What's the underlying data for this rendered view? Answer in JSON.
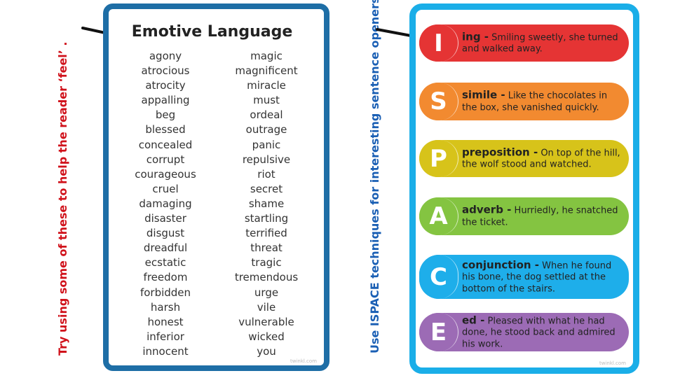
{
  "left_note": "Try using some of these to help the reader ‘feel’ .",
  "right_note": "Use ISPACE techniques for interesting sentence openers!",
  "emotive": {
    "title": "Emotive Language",
    "col1": [
      "agony",
      "atrocious",
      "atrocity",
      "appalling",
      "beg",
      "blessed",
      "concealed",
      "corrupt",
      "courageous",
      "cruel",
      "damaging",
      "disaster",
      "disgust",
      "dreadful",
      "ecstatic",
      "freedom",
      "forbidden",
      "harsh",
      "honest",
      "inferior",
      "innocent"
    ],
    "col2": [
      "magic",
      "magnificent",
      "miracle",
      "must",
      "ordeal",
      "outrage",
      "panic",
      "repulsive",
      "riot",
      "secret",
      "shame",
      "startling",
      "terrified",
      "threat",
      "tragic",
      "tremendous",
      "urge",
      "vile",
      "vulnerable",
      "wicked",
      "you"
    ],
    "watermark": "twinkl.com"
  },
  "ispace": {
    "watermark": "twinkl.com",
    "items": [
      {
        "letter": "I",
        "term": "ing -",
        "example": "Smiling sweetly, she turned and walked away.",
        "color": "#e53434"
      },
      {
        "letter": "S",
        "term": "simile -",
        "example": "Like the chocolates in the box, she vanished quickly.",
        "color": "#f28a30"
      },
      {
        "letter": "P",
        "term": "preposition -",
        "example": "On top of the hill, the wolf stood and watched.",
        "color": "#d7c31a"
      },
      {
        "letter": "A",
        "term": "adverb -",
        "example": "Hurriedly, he snatched the ticket.",
        "color": "#84c441"
      },
      {
        "letter": "C",
        "term": "conjunction -",
        "example": "When he found his bone, the dog settled at the bottom of the stairs.",
        "color": "#1eaeea"
      },
      {
        "letter": "E",
        "term": "ed -",
        "example": "Pleased with what he had done, he stood back and admired his work.",
        "color": "#9c6bb5"
      }
    ]
  }
}
